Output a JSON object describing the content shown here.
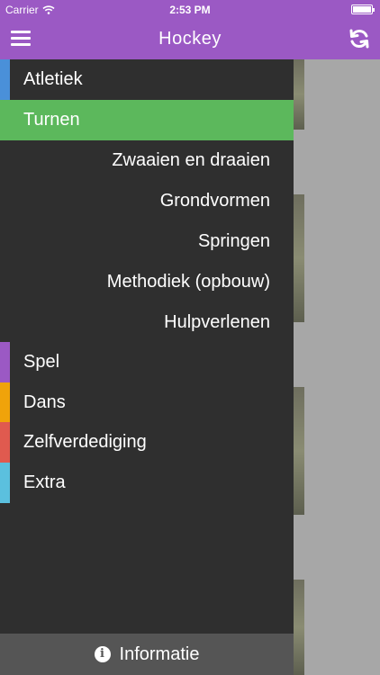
{
  "status_bar": {
    "carrier": "Carrier",
    "time": "2:53 PM"
  },
  "header": {
    "title": "Hockey"
  },
  "colors": {
    "header": "#9b59c4",
    "drawer": "#2f2f2f",
    "active": "#5cb85c",
    "atletiek": "#4a90d9",
    "spel": "#9b59c4",
    "dans": "#f0a30a",
    "zelfverdediging": "#e05a4f",
    "extra": "#5bc0de"
  },
  "menu": {
    "items": [
      {
        "label": "Atletiek"
      },
      {
        "label": "Turnen"
      },
      {
        "label": "Spel"
      },
      {
        "label": "Dans"
      },
      {
        "label": "Zelfverdediging"
      },
      {
        "label": "Extra"
      }
    ],
    "subitems": [
      {
        "label": "Zwaaien en draaien"
      },
      {
        "label": "Grondvormen"
      },
      {
        "label": "Springen"
      },
      {
        "label": "Methodiek (opbouw)"
      },
      {
        "label": "Hulpverlenen"
      }
    ]
  },
  "footer": {
    "label": "Informatie"
  }
}
